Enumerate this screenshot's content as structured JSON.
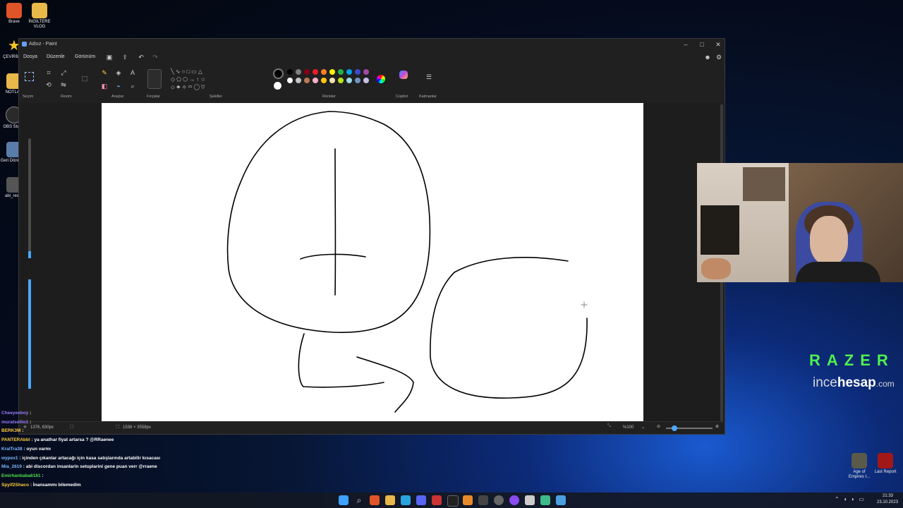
{
  "desktop": {
    "icons": [
      {
        "label": "Brave",
        "color": "#e0542a"
      },
      {
        "label": "İNGİLTERE VLOG",
        "color": "#e9b84a"
      },
      {
        "label": "ÇEVİRİLER",
        "color": "#f3c623"
      },
      {
        "label": "NOTLAR",
        "color": "#e9b84a"
      },
      {
        "label": "OBS Studio",
        "color": "#2a2a2a"
      },
      {
        "label": "Geri Dönüşüm",
        "color": "#5a7ca8"
      },
      {
        "label": "abi_resim",
        "color": "#555"
      }
    ],
    "right_icons": [
      {
        "label": "Age of Empires I...",
        "color": "#5a5a4a"
      },
      {
        "label": "Last Report",
        "color": "#a01818"
      }
    ]
  },
  "paint": {
    "title": "Adsız - Paint",
    "menus": [
      "Dosya",
      "Düzenle",
      "Görünüm"
    ],
    "groups": [
      "Seçim",
      "Resim",
      "Araçlar",
      "Fırçalar",
      "Şekiller",
      "Renkler",
      "Copilot",
      "Katmanlar"
    ],
    "palette_row1": [
      "#000000",
      "#7f7f7f",
      "#880015",
      "#ed1c24",
      "#ff7f27",
      "#fff200",
      "#22b14c",
      "#00a2e8",
      "#3f48cc",
      "#a349a4"
    ],
    "palette_row2": [
      "#ffffff",
      "#c3c3c3",
      "#b97a57",
      "#ffaec9",
      "#ffc90e",
      "#efe4b0",
      "#b5e61d",
      "#99d9ea",
      "#7092be",
      "#c8bfe7"
    ],
    "status": {
      "cursor_pos": "1376, 630px",
      "image_size": "1536 × 3558px",
      "zoom": "%100"
    }
  },
  "chat": [
    {
      "user": "Cheeyeeboy",
      "message": ""
    },
    {
      "user": "muratsellio1",
      "message": ""
    },
    {
      "user": "BERK3M",
      "message": ""
    },
    {
      "user": "PANTERAbbl",
      "message": "ya anathar fiyat artarsa ? @RRaenee"
    },
    {
      "user": "KralTra38",
      "message": "oyun varmı"
    },
    {
      "user": "wypex1",
      "message": "içinden çıkanlar artacağı için kasa satışlarında artabilir kısacası"
    },
    {
      "user": "Mia_2619",
      "message": "abi discordan insanlarin setuplarini gene puan verr @rraene"
    },
    {
      "user": "Emirhanbaba6161",
      "message": ""
    },
    {
      "user": "Spyif2Shaco",
      "message": "İnansammı bilemedim"
    }
  ],
  "branding": {
    "razer": "RAZER",
    "ince": "ince",
    "hesap": "hesap",
    "com": ".com"
  },
  "taskbar": {
    "time": "21:33",
    "date": "23.10.2023"
  }
}
